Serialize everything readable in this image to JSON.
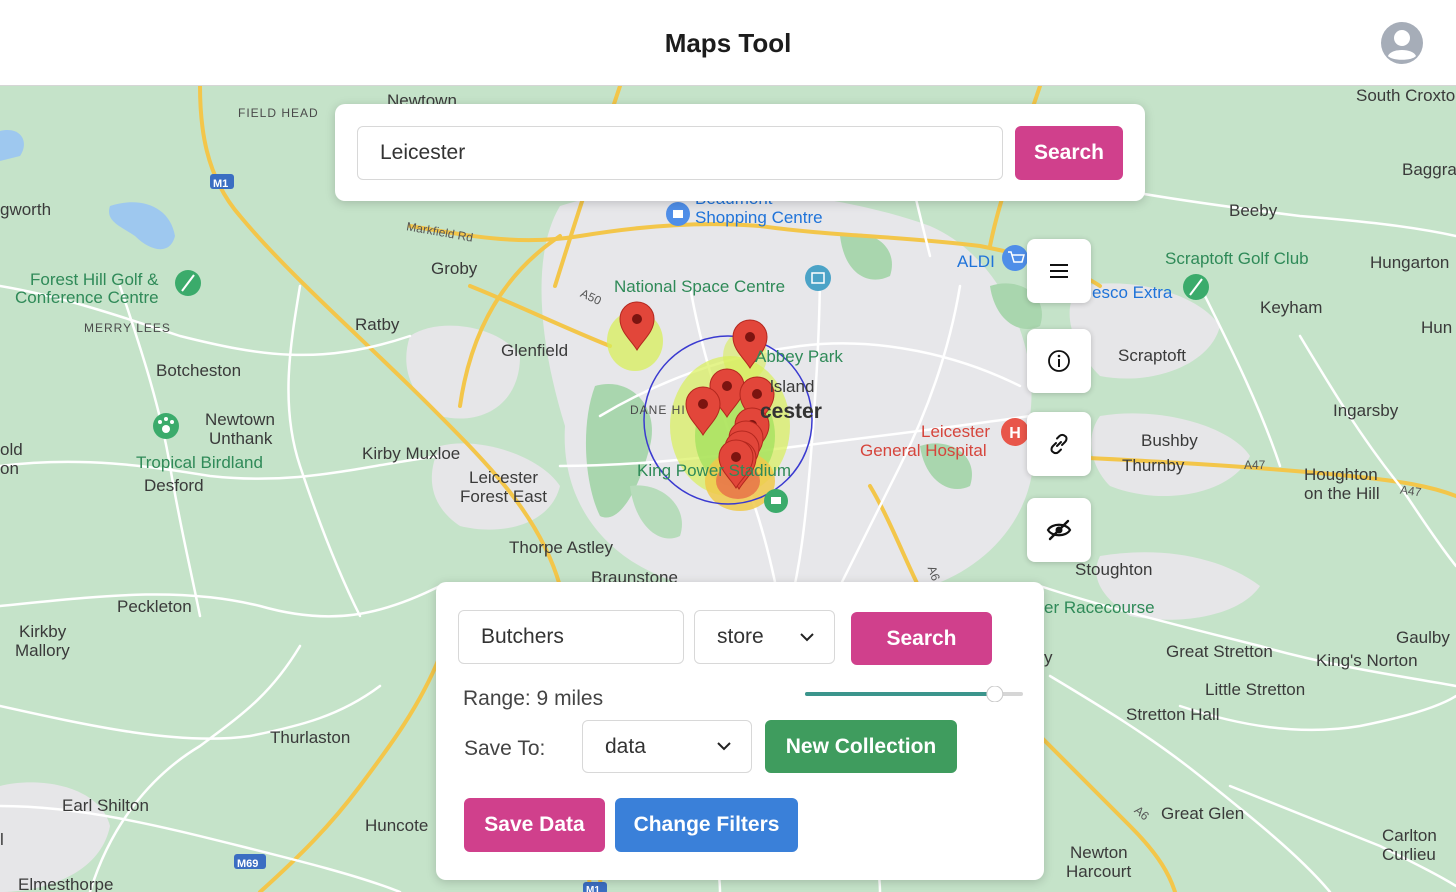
{
  "header": {
    "title": "Maps Tool",
    "avatar_icon": "user-circle-icon"
  },
  "search": {
    "value": "Leicester",
    "button_label": "Search"
  },
  "tools": [
    {
      "icon": "menu-icon"
    },
    {
      "icon": "info-icon"
    },
    {
      "icon": "link-icon"
    },
    {
      "icon": "eye-off-icon"
    }
  ],
  "filters": {
    "keyword": "Butchers",
    "type_select": "store",
    "search_label": "Search",
    "range_label": "Range: 9 miles",
    "range_fraction": 0.9,
    "save_to_label": "Save To:",
    "collection_select": "data",
    "new_collection_label": "New Collection",
    "save_data_label": "Save Data",
    "change_filters_label": "Change Filters"
  },
  "map": {
    "place_labels": {
      "newtown": "Newtown",
      "field_head": "FIELD HEAD",
      "south_croxton": "South Croxto",
      "baggrave": "Baggra",
      "gworth": "gworth",
      "markfield_rd": "Markfield Rd",
      "beaumont": "Beaumont",
      "shopping_centre": "Shopping Centre",
      "beeby": "Beeby",
      "forest_hill": "Forest Hill Golf &",
      "conference_centre": "Conference Centre",
      "merry_lees": "MERRY LEES",
      "groby": "Groby",
      "a50": "A50",
      "national_space_centre": "National Space Centre",
      "aldi": "ALDI",
      "scraptoft_golf": "Scraptoft Golf Club",
      "hungarton": "Hungarton",
      "tesco": "esco Extra",
      "keyham": "Keyham",
      "hun": "Hun",
      "ratby": "Ratby",
      "glenfield": "Glenfield",
      "abbey_park": "Abbey Park",
      "scraptoft": "Scraptoft",
      "botcheston": "Botcheston",
      "belgrave": "lsland",
      "leicester": "cester",
      "dane_hills": "DANE HI",
      "newtown_unthank_1": "Newtown",
      "newtown_unthank_2": "Unthank",
      "ingarsby": "Ingarsby",
      "old": "old",
      "on": "on",
      "kirby_muxloe": "Kirby Muxloe",
      "leicester_forest_1": "Leicester",
      "leicester_forest_2": "Forest East",
      "general_hospital_1": "Leicester",
      "general_hospital_2": "General Hospital",
      "bushby": "Bushby",
      "thurnby": "Thurnby",
      "tropical_birdland": "Tropical Birdland",
      "desford": "Desford",
      "king_power": "King Power Stadium",
      "a47": "A47",
      "houghton_1": "Houghton",
      "houghton_2": "on the Hill",
      "a47b": "A47",
      "thorpe_astley": "Thorpe Astley",
      "braunstone": "Braunstone",
      "stoughton": "Stoughton",
      "racecourse": "er Racecourse",
      "peckleton": "Peckleton",
      "kirkby_1": "Kirkby",
      "kirkby_2": "Mallory",
      "gaulby": "Gaulby",
      "great_stretton": "Great Stretton",
      "kings_norton": "King's Norton",
      "y": "y",
      "little_stretton": "Little Stretton",
      "stretton_hall": "Stretton Hall",
      "thurlaston": "Thurlaston",
      "earl_shilton": "Earl Shilton",
      "huncote": "Huncote",
      "m69": "M69",
      "m1": "M1",
      "m1b": "M1",
      "a6": "A6",
      "a6b": "A6",
      "great_glen": "Great Glen",
      "carlton_1": "Carlton",
      "carlton_2": "Curlieu",
      "newton_1": "Newton",
      "newton_2": "Harcourt",
      "elmesthorpe": "Elmesthorpe",
      "l": "l"
    },
    "accent_colors": {
      "pink": "#d0408c",
      "green": "#3f9c5e",
      "blue": "#3a80d9",
      "radius_circle": "#3a3ad0",
      "pin": "#e2463a"
    }
  }
}
